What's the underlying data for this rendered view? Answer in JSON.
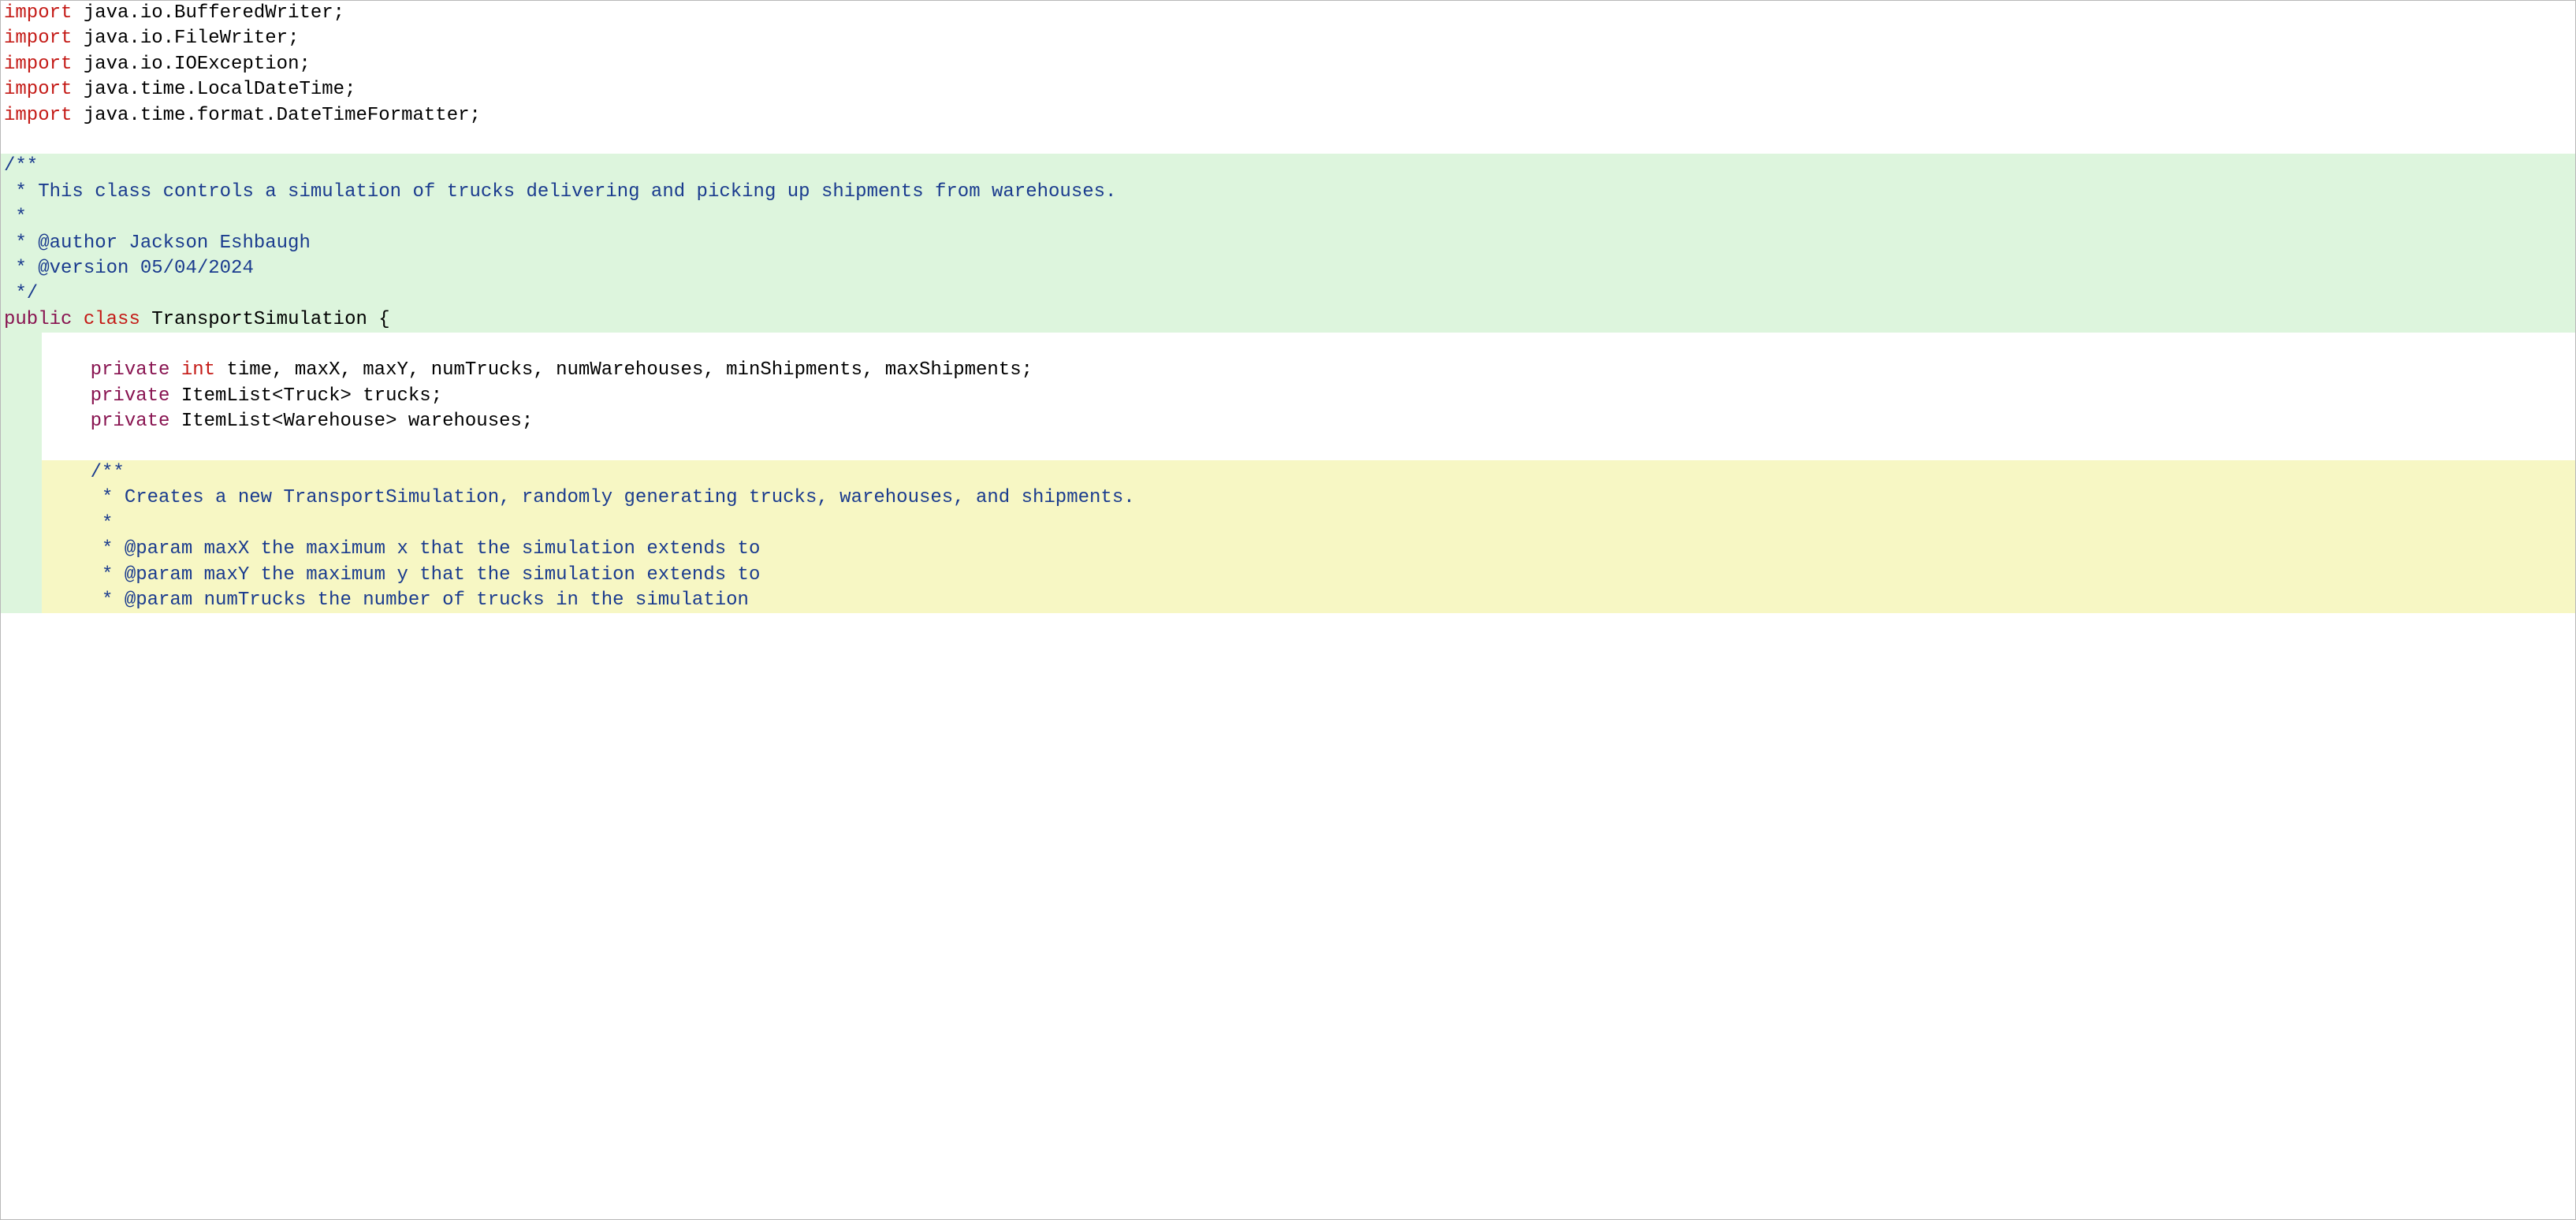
{
  "imports": {
    "kw": "import",
    "lines": [
      " java.io.BufferedWriter;",
      " java.io.FileWriter;",
      " java.io.IOException;",
      " java.time.LocalDateTime;",
      " java.time.format.DateTimeFormatter;"
    ]
  },
  "classdoc": {
    "open": "/**",
    "l1": " * This class controls a simulation of trucks delivering and picking up shipments from warehouses.",
    "l2": " *",
    "l3": " * @author Jackson Eshbaugh",
    "l4": " * @version 05/04/2024",
    "close": " */"
  },
  "classdecl": {
    "kw_public": "public",
    "kw_class": "class",
    "rest": " TransportSimulation {"
  },
  "fields": {
    "line1_kw1": "    private",
    "line1_kw2": " int",
    "line1_rest": " time, maxX, maxY, numTrucks, numWarehouses, minShipments, maxShipments;",
    "line2_kw": "    private",
    "line2_rest": " ItemList<Truck> trucks;",
    "line3_kw": "    private",
    "line3_rest": " ItemList<Warehouse> warehouses;"
  },
  "ctordoc": {
    "open": "    /**",
    "l1": "     * Creates a new TransportSimulation, randomly generating trucks, warehouses, and shipments.",
    "l2": "     *",
    "l3": "     * @param maxX the maximum x that the simulation extends to",
    "l4": "     * @param maxY the maximum y that the simulation extends to",
    "l5": "     * @param numTrucks the number of trucks in the simulation"
  }
}
